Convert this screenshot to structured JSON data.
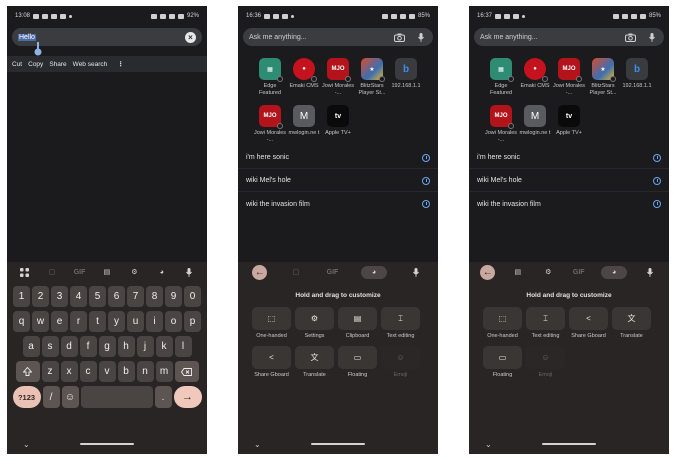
{
  "screen1": {
    "status": {
      "time": "13:08",
      "battery": "92%"
    },
    "search": {
      "text": "Hello"
    },
    "context_menu": [
      "Cut",
      "Copy",
      "Share",
      "Web search"
    ],
    "toolbar": {
      "gif": "GIF"
    },
    "rows": [
      [
        "1",
        "2",
        "3",
        "4",
        "5",
        "6",
        "7",
        "8",
        "9",
        "0"
      ],
      [
        "q",
        "w",
        "e",
        "r",
        "t",
        "y",
        "u",
        "i",
        "o",
        "p"
      ],
      [
        "a",
        "s",
        "d",
        "f",
        "g",
        "h",
        "j",
        "k",
        "l"
      ],
      [
        "z",
        "x",
        "c",
        "v",
        "b",
        "n",
        "m"
      ]
    ],
    "bottom": {
      "sym": "?123",
      "slash": "/",
      "emoji": "☺",
      "period": ".",
      "enter": "→"
    }
  },
  "screen2": {
    "status": {
      "time": "16:36",
      "battery": "85%"
    },
    "search": {
      "placeholder": "Ask me anything..."
    },
    "shortcuts": [
      {
        "label": "Edge Featured",
        "icon": "edge-icon"
      },
      {
        "label": "Emaki CMS",
        "icon": "emaki-icon"
      },
      {
        "label": "Jowi Morales -...",
        "icon": "jowi-icon",
        "badge": "MJO"
      },
      {
        "label": "BlitzStars Player St...",
        "icon": "blitzstars-icon"
      },
      {
        "label": "192.168.1.1",
        "icon": "bing-icon",
        "glyph": "b"
      },
      {
        "label": "Jowi Morales -...",
        "icon": "jowi-icon",
        "badge": "MJO"
      },
      {
        "label": "mwlogin.ne t",
        "icon": "letter-icon",
        "glyph": "M"
      },
      {
        "label": "Apple TV+",
        "icon": "appletv-icon",
        "glyph": "tv"
      }
    ],
    "suggestions": [
      "i'm here sonic",
      "wiki Mel's hole",
      "wiki the invasion film"
    ],
    "toolbar": {
      "gif": "GIF"
    },
    "hint": "Hold and drag to customize",
    "options": [
      {
        "label": "One-handed",
        "glyph": "⬚"
      },
      {
        "label": "Settings",
        "glyph": "⚙"
      },
      {
        "label": "Clipboard",
        "glyph": "▤"
      },
      {
        "label": "Text editing",
        "glyph": "⌶"
      },
      {
        "label": "Share Gboard",
        "glyph": "<"
      },
      {
        "label": "Translate",
        "glyph": "文"
      },
      {
        "label": "Floating",
        "glyph": "▭"
      },
      {
        "label": "Emoji",
        "glyph": "☺",
        "disabled": true
      }
    ]
  },
  "screen3": {
    "status": {
      "time": "16:37",
      "battery": "85%"
    },
    "search": {
      "placeholder": "Ask me anything..."
    },
    "shortcuts": [
      {
        "label": "Edge Featured",
        "icon": "edge-icon"
      },
      {
        "label": "Emaki CMS",
        "icon": "emaki-icon"
      },
      {
        "label": "Jowi Morales -...",
        "icon": "jowi-icon",
        "badge": "MJO"
      },
      {
        "label": "BlitzStars Player St...",
        "icon": "blitzstars-icon"
      },
      {
        "label": "192.168.1.1",
        "icon": "bing-icon",
        "glyph": "b"
      },
      {
        "label": "Jowi Morales -...",
        "icon": "jowi-icon",
        "badge": "MJO"
      },
      {
        "label": "mwlogin.ne t",
        "icon": "letter-icon",
        "glyph": "M"
      },
      {
        "label": "Apple TV+",
        "icon": "appletv-icon",
        "glyph": "tv"
      }
    ],
    "suggestions": [
      "i'm here sonic",
      "wiki Mel's hole",
      "wiki the invasion film"
    ],
    "toolbar": {
      "gif": "GIF"
    },
    "hint": "Hold and drag to customize",
    "options": [
      {
        "label": "One-handed",
        "glyph": "⬚"
      },
      {
        "label": "Text editing",
        "glyph": "⌶"
      },
      {
        "label": "Share Gboard",
        "glyph": "<"
      },
      {
        "label": "Translate",
        "glyph": "文"
      },
      {
        "label": "Floating",
        "glyph": "▭"
      },
      {
        "label": "Emoji",
        "glyph": "☺",
        "disabled": true
      }
    ]
  },
  "colors": {
    "accent": "#f1c9bc",
    "link_blue": "#6aa6f0",
    "keyboard_bg": "#282524",
    "page_bg": "#1b1b1d"
  }
}
